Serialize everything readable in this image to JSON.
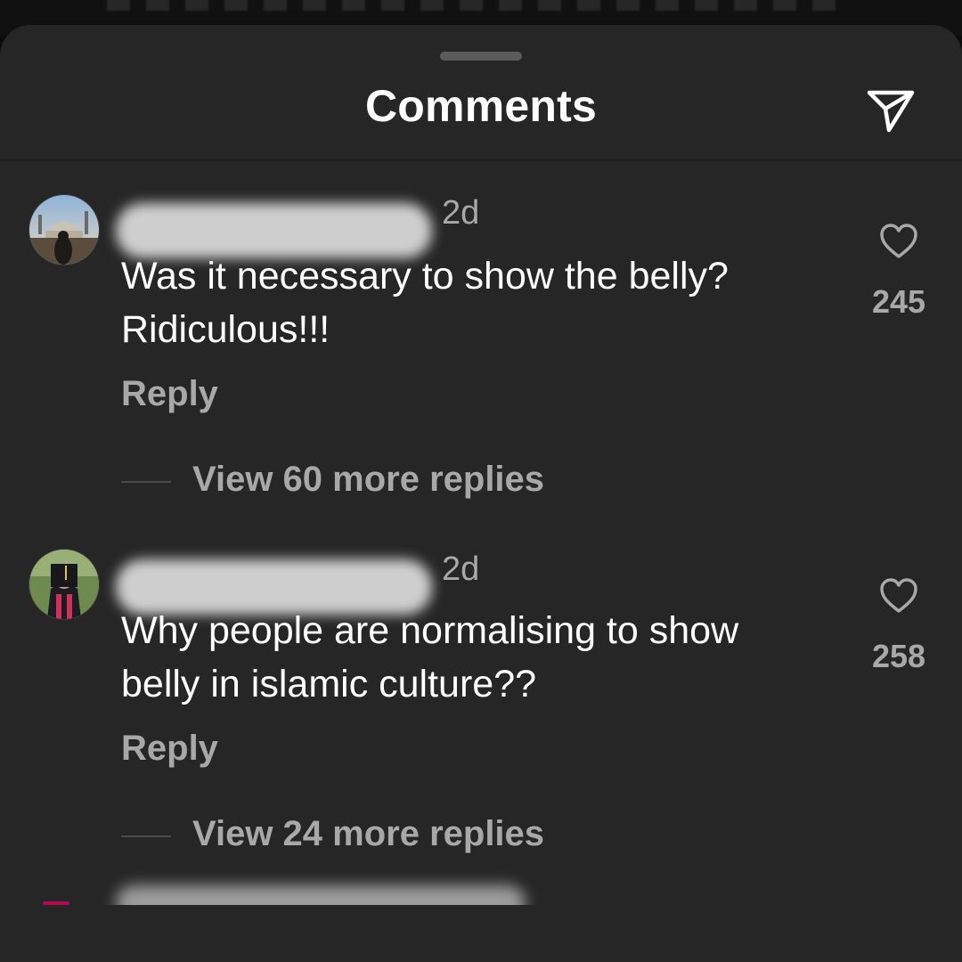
{
  "header": {
    "title": "Comments",
    "share_icon": "send-icon"
  },
  "comments": [
    {
      "time": "2d",
      "text": "Was it necessary to show the belly? Ridiculous!!!",
      "reply_label": "Reply",
      "view_replies": "View 60 more replies",
      "likes": "245"
    },
    {
      "time": "2d",
      "text": "Why people are normalising to show belly in islamic culture??",
      "reply_label": "Reply",
      "view_replies": "View 24 more replies",
      "likes": "258"
    }
  ],
  "colors": {
    "sheet_background": "#262626",
    "primary_text": "#ffffff",
    "secondary_text": "#a8a8a8"
  }
}
